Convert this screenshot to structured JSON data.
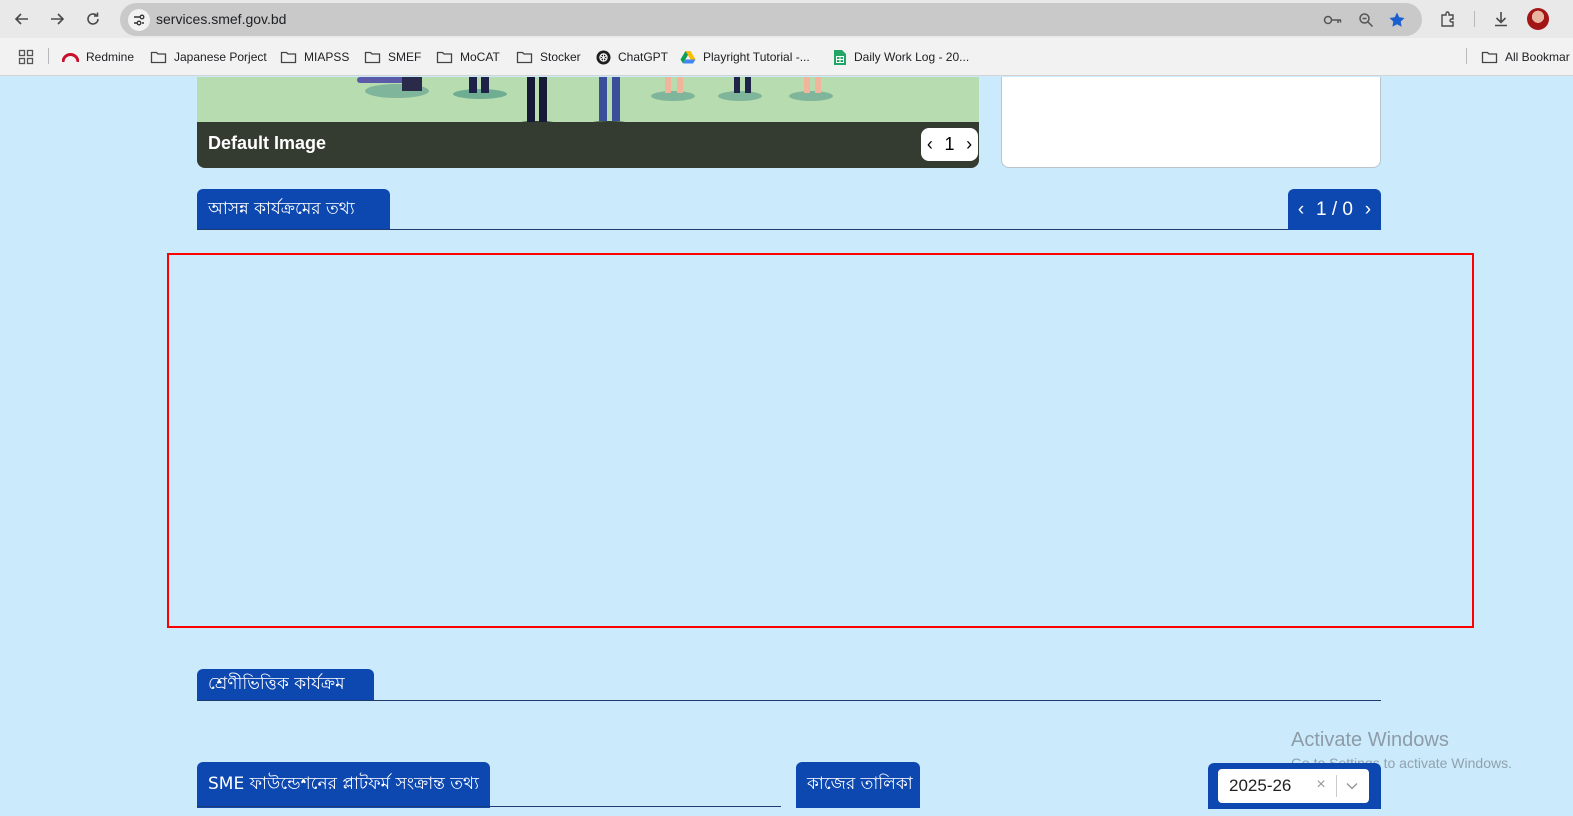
{
  "browser": {
    "url": "services.smef.gov.bd",
    "bookmarks": [
      {
        "label": "Redmine",
        "icon": "redmine-icon"
      },
      {
        "label": "Japanese Porject",
        "icon": "folder-icon"
      },
      {
        "label": "MIAPSS",
        "icon": "folder-icon"
      },
      {
        "label": "SMEF",
        "icon": "folder-icon"
      },
      {
        "label": "MoCAT",
        "icon": "folder-icon"
      },
      {
        "label": "Stocker",
        "icon": "folder-icon"
      },
      {
        "label": "ChatGPT",
        "icon": "chatgpt-icon"
      },
      {
        "label": "Playright Tutorial -...",
        "icon": "google-drive-icon"
      },
      {
        "label": "Daily Work Log - 20...",
        "icon": "google-sheets-icon"
      }
    ],
    "all_bookmarks": "All Bookmar"
  },
  "hero": {
    "title": "Default Image",
    "page": "1",
    "prev": "‹",
    "next": "›"
  },
  "upcoming": {
    "title": "আসন্ন কার্যক্রমের তথ্য",
    "pager": "1 / 0",
    "prev": "‹",
    "next": "›"
  },
  "category": {
    "title": "শ্রেণীভিত্তিক কার্যক্রম"
  },
  "platform_info": {
    "title": "SME ফাউন্ডেশনের প্লাটফর্ম সংক্রান্ত তথ্য"
  },
  "task_list": {
    "title": "কাজের তালিকা",
    "year_value": "2025-26",
    "clear": "×"
  },
  "watermark": {
    "line1": "Activate Windows",
    "line2": "Go to Settings to activate Windows."
  },
  "colors": {
    "page_bg": "#cbeafb",
    "accent": "#0d47b0",
    "highlight": "#ff0000"
  }
}
